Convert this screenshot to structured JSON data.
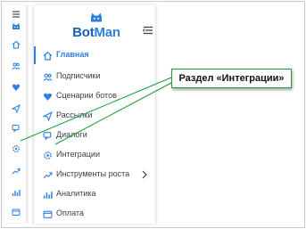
{
  "brand": {
    "name_part1": "Bot",
    "name_part2": "Man"
  },
  "rail_icons": [
    "menu-icon",
    "logo-icon",
    "home-icon",
    "users-icon",
    "heart-icon",
    "send-icon",
    "chat-icon",
    "gear-icon",
    "trending-icon",
    "bar-chart-icon",
    "card-icon"
  ],
  "nav": {
    "items": [
      {
        "label": "Главная",
        "icon": "home-icon",
        "active": true
      },
      {
        "label": "Подписчики",
        "icon": "users-icon"
      },
      {
        "label": "Сценарии ботов",
        "icon": "heart-icon"
      },
      {
        "label": "Рассылки",
        "icon": "send-icon"
      },
      {
        "label": "Диалоги",
        "icon": "chat-icon"
      },
      {
        "label": "Интеграции",
        "icon": "gear-icon"
      },
      {
        "label": "Инструменты роста",
        "icon": "trending-icon",
        "has_submenu": true
      },
      {
        "label": "Аналитика",
        "icon": "bar-chart-icon"
      },
      {
        "label": "Оплата",
        "icon": "card-icon"
      }
    ]
  },
  "callout": {
    "text": "Раздел «Интеграции»"
  },
  "colors": {
    "accent": "#2f7fe0",
    "callout_border": "#1a9c3a",
    "text": "#3a3f4a"
  }
}
